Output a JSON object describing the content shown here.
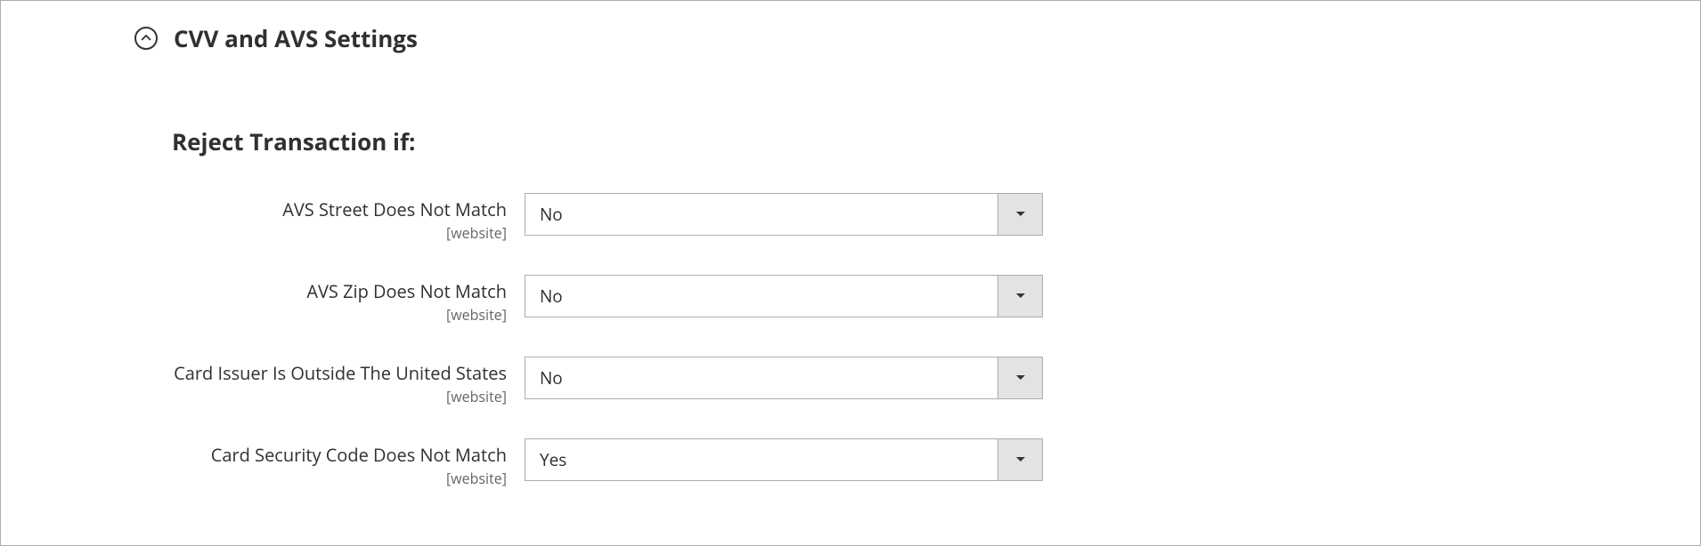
{
  "section": {
    "title": "CVV and AVS Settings"
  },
  "subsection": {
    "title": "Reject Transaction if:"
  },
  "fields": [
    {
      "label": "AVS Street Does Not Match",
      "scope": "[website]",
      "value": "No"
    },
    {
      "label": "AVS Zip Does Not Match",
      "scope": "[website]",
      "value": "No"
    },
    {
      "label": "Card Issuer Is Outside The United States",
      "scope": "[website]",
      "value": "No"
    },
    {
      "label": "Card Security Code Does Not Match",
      "scope": "[website]",
      "value": "Yes"
    }
  ]
}
